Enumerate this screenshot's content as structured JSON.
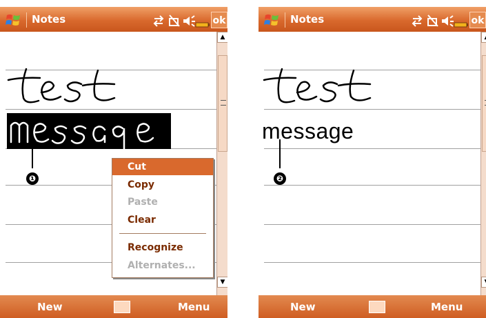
{
  "screens": [
    {
      "app_title": "Notes",
      "ok_label": "ok",
      "handwriting": [
        "test",
        "message"
      ],
      "callout_number": "❶",
      "context_menu": {
        "items": [
          {
            "label": "Cut",
            "state": "selected"
          },
          {
            "label": "Copy",
            "state": "enabled"
          },
          {
            "label": "Paste",
            "state": "disabled"
          },
          {
            "label": "Clear",
            "state": "enabled"
          },
          {
            "label": "Recognize",
            "state": "enabled"
          },
          {
            "label": "Alternates...",
            "state": "disabled"
          }
        ]
      },
      "bottom_bar": {
        "left": "New",
        "right": "Menu"
      }
    },
    {
      "app_title": "Notes",
      "ok_label": "ok",
      "handwriting": [
        "test"
      ],
      "recognized_text": "message",
      "callout_number": "❷",
      "bottom_bar": {
        "left": "New",
        "right": "Menu"
      }
    }
  ],
  "colors": {
    "accent": "#d9692d",
    "menu_text": "#7a2b00",
    "disabled": "#b0b0b0"
  },
  "icons": [
    "windows-flag-icon",
    "connectivity-icon",
    "no-signal-icon",
    "speaker-icon",
    "battery-icon",
    "keyboard-icon",
    "scroll-up-icon",
    "scroll-down-icon"
  ]
}
